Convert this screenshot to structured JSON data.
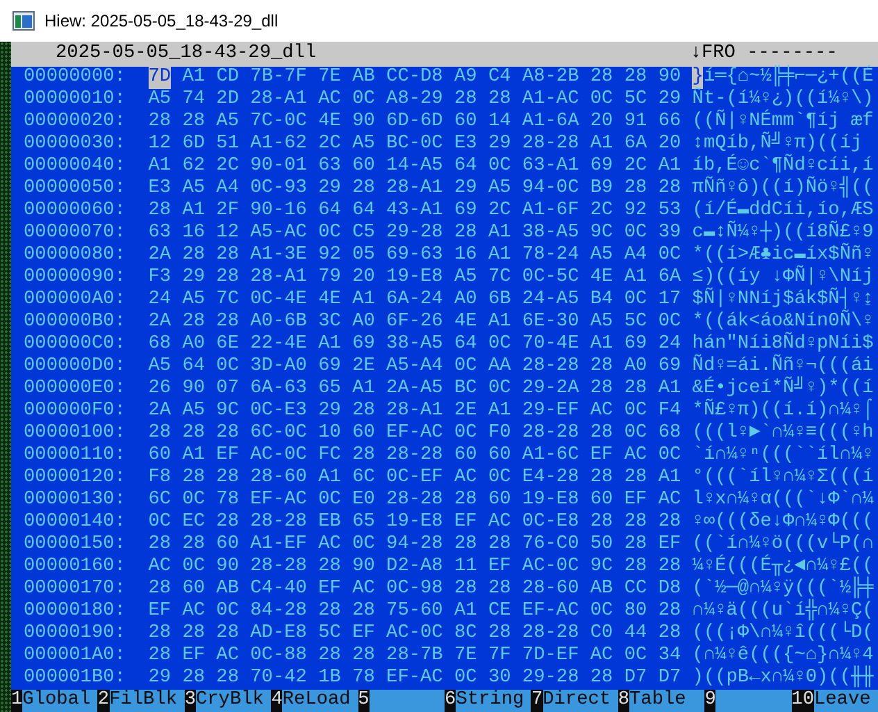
{
  "window": {
    "title": "Hiew: 2025-05-05_18-43-29_dll"
  },
  "header": {
    "filename": "2025-05-05_18-43-29_dll",
    "mode": "↓FRO --------"
  },
  "rows": [
    {
      "address": "00000000:",
      "hex": "7D A1 CD 7B-7F 7E AB CC-D8 A9 C4 A8-2B 28 28 90",
      "text": "}í═{⌂~½╠╪⌐─¿+((É",
      "cursor": true
    },
    {
      "address": "00000010:",
      "hex": "A5 74 2D 28-A1 AC 0C A8-29 28 28 A1-AC 0C 5C 29",
      "text": "Ñt-(í¼♀¿)((í¼♀\\)",
      "cursor": false
    },
    {
      "address": "00000020:",
      "hex": "28 28 A5 7C-0C 4E 90 6D-6D 60 14 A1-6A 20 91 66",
      "text": "((Ñ|♀NÉmm`¶íj æf",
      "cursor": false
    },
    {
      "address": "00000030:",
      "hex": "12 6D 51 A1-62 2C A5 BC-0C E3 29 28-28 A1 6A 20",
      "text": "↕mQíb,Ñ╝♀π)((íj",
      "cursor": false
    },
    {
      "address": "00000040:",
      "hex": "A1 62 2C 90-01 63 60 14-A5 64 0C 63-A1 69 2C A1",
      "text": "íb,É☺c`¶Ñd♀cíi,í",
      "cursor": false
    },
    {
      "address": "00000050:",
      "hex": "E3 A5 A4 0C-93 29 28 28-A1 29 A5 94-0C B9 28 28",
      "text": "πÑñ♀ô)((í)Ñö♀╣((",
      "cursor": false
    },
    {
      "address": "00000060:",
      "hex": "28 A1 2F 90-16 64 64 43-A1 69 2C A1-6F 2C 92 53",
      "text": "(í/É▬ddCíi,ío,ÆS",
      "cursor": false
    },
    {
      "address": "00000070:",
      "hex": "63 16 12 A5-AC 0C C5 29-28 28 A1 38-A5 9C 0C 39",
      "text": "c▬↕Ñ¼♀┼)((í8Ñ£♀9",
      "cursor": false
    },
    {
      "address": "00000080:",
      "hex": "2A 28 28 A1-3E 92 05 69-63 16 A1 78-24 A5 A4 0C",
      "text": "*((í>Æ♣ic▬íx$Ññ♀",
      "cursor": false
    },
    {
      "address": "00000090:",
      "hex": "F3 29 28 28-A1 79 20 19-E8 A5 7C 0C-5C 4E A1 6A",
      "text": "≤)((íy ↓ΦÑ|♀\\Níj",
      "cursor": false
    },
    {
      "address": "000000A0:",
      "hex": "24 A5 7C 0C-4E 4E A1 6A-24 A0 6B 24-A5 B4 0C 17",
      "text": "$Ñ|♀NNíj$ák$Ñ┤♀↨",
      "cursor": false
    },
    {
      "address": "000000B0:",
      "hex": "2A 28 28 A0-6B 3C A0 6F-26 4E A1 6E-30 A5 5C 0C",
      "text": "*((ák<áo&Nín0Ñ\\♀",
      "cursor": false
    },
    {
      "address": "000000C0:",
      "hex": "68 A0 6E 22-4E A1 69 38-A5 64 0C 70-4E A1 69 24",
      "text": "hán\"Níi8Ñd♀pNíi$",
      "cursor": false
    },
    {
      "address": "000000D0:",
      "hex": "A5 64 0C 3D-A0 69 2E A5-A4 0C AA 28-28 28 A0 69",
      "text": "Ñd♀=ái.Ññ♀¬(((ái",
      "cursor": false
    },
    {
      "address": "000000E0:",
      "hex": "26 90 07 6A-63 65 A1 2A-A5 BC 0C 29-2A 28 28 A1",
      "text": "&É•jceí*Ñ╝♀)*((í",
      "cursor": false
    },
    {
      "address": "000000F0:",
      "hex": "2A A5 9C 0C-E3 29 28 28-A1 2E A1 29-EF AC 0C F4",
      "text": "*Ñ£♀π)((í.í)∩¼♀⌠",
      "cursor": false
    },
    {
      "address": "00000100:",
      "hex": "28 28 28 6C-0C 10 60 EF-AC 0C F0 28-28 28 0C 68",
      "text": "(((l♀►`∩¼♀≡(((♀h",
      "cursor": false
    },
    {
      "address": "00000110:",
      "hex": "60 A1 EF AC-0C FC 28 28-28 60 60 A1-6C EF AC 0C",
      "text": "`í∩¼♀ⁿ(((``íl∩¼♀",
      "cursor": false
    },
    {
      "address": "00000120:",
      "hex": "F8 28 28 28-60 A1 6C 0C-EF AC 0C E4-28 28 28 A1",
      "text": "°(((`íl♀∩¼♀Σ(((í",
      "cursor": false
    },
    {
      "address": "00000130:",
      "hex": "6C 0C 78 EF-AC 0C E0 28-28 28 60 19-E8 60 EF AC",
      "text": "l♀x∩¼♀α(((`↓Φ`∩¼",
      "cursor": false
    },
    {
      "address": "00000140:",
      "hex": "0C EC 28 28-28 EB 65 19-E8 EF AC 0C-E8 28 28 28",
      "text": "♀∞(((δe↓Φ∩¼♀Φ(((",
      "cursor": false
    },
    {
      "address": "00000150:",
      "hex": "28 28 60 A1-EF AC 0C 94-28 28 28 76-C0 50 28 EF",
      "text": "((`í∩¼♀ö(((v└P(∩",
      "cursor": false
    },
    {
      "address": "00000160:",
      "hex": "AC 0C 90 28-28 28 90 D2-A8 11 EF AC-0C 9C 28 28",
      "text": "¼♀É(((É╥¿◄∩¼♀£((",
      "cursor": false
    },
    {
      "address": "00000170:",
      "hex": "28 60 AB C4-40 EF AC 0C-98 28 28 28-60 AB CC D8",
      "text": "(`½─@∩¼♀ÿ(((`½╠╪",
      "cursor": false
    },
    {
      "address": "00000180:",
      "hex": "EF AC 0C 84-28 28 28 75-60 A1 CE EF-AC 0C 80 28",
      "text": "∩¼♀ä(((u`í╬∩¼♀Ç(",
      "cursor": false
    },
    {
      "address": "00000190:",
      "hex": "28 28 28 AD-E8 5C EF AC-0C 8C 28 28-28 C0 44 28",
      "text": "(((¡Φ\\∩¼♀î(((└D(",
      "cursor": false
    },
    {
      "address": "000001A0:",
      "hex": "28 EF AC 0C-88 28 28 28-7B 7E 7F 7D-EF AC 0C 34",
      "text": "(∩¼♀ê((({~⌂}∩¼♀4",
      "cursor": false
    },
    {
      "address": "000001B0:",
      "hex": "29 28 28 70-42 1B 78 EF-AC 0C 30 29-28 28 D7 D7",
      "text": ")((pB←x∩¼♀0)((╫╫",
      "cursor": false
    }
  ],
  "function_keys": [
    {
      "key": "1",
      "label": "Global"
    },
    {
      "key": "2",
      "label": "FilBlk"
    },
    {
      "key": "3",
      "label": "CryBlk"
    },
    {
      "key": "4",
      "label": "ReLoad"
    },
    {
      "key": "5"
    },
    {
      "key": "6",
      "label": "String"
    },
    {
      "key": "7",
      "label": "Direct"
    },
    {
      "key": "8",
      "label": "Table"
    },
    {
      "key": "9"
    },
    {
      "key": "10",
      "label": "Leave"
    }
  ]
}
